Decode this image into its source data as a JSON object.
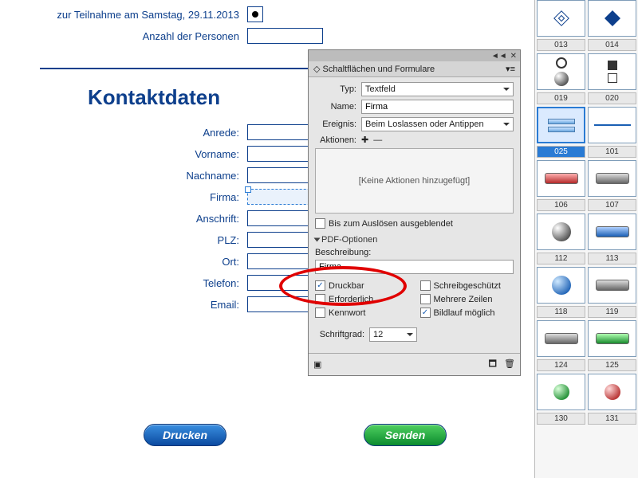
{
  "form": {
    "participation_label": "zur Teilnahme am Samstag, 29.11.2013",
    "persons_label": "Anzahl der Personen",
    "section_title": "Kontaktdaten",
    "fields": {
      "anrede": "Anrede:",
      "vorname": "Vorname:",
      "nachname": "Nachname:",
      "firma": "Firma:",
      "anschrift": "Anschrift:",
      "plz": "PLZ:",
      "ort": "Ort:",
      "telefon": "Telefon:",
      "email": "Email:"
    },
    "buttons": {
      "print": "Drucken",
      "send": "Senden"
    }
  },
  "panel": {
    "tab_title": "Schaltflächen und Formulare",
    "typ_label": "Typ:",
    "typ_value": "Textfeld",
    "name_label": "Name:",
    "name_value": "Firma",
    "ereignis_label": "Ereignis:",
    "ereignis_value": "Beim Loslassen oder Antippen",
    "aktionen_label": "Aktionen:",
    "no_actions": "[Keine Aktionen hinzugefügt]",
    "hide_until_trigger": "Bis zum Auslösen ausgeblendet",
    "pdf_options": "PDF-Optionen",
    "beschreibung_label": "Beschreibung:",
    "beschreibung_value": "Firma",
    "cb_druckbar": "Druckbar",
    "cb_schreibgeschuetzt": "Schreibgeschützt",
    "cb_erforderlich": "Erforderlich",
    "cb_mehrere_zeilen": "Mehrere Zeilen",
    "cb_kennwort": "Kennwort",
    "cb_bildlauf": "Bildlauf möglich",
    "schriftgrad_label": "Schriftgrad:",
    "schriftgrad_value": "12",
    "checks": {
      "druckbar": true,
      "schreibgeschuetzt": false,
      "erforderlich": false,
      "mehrere_zeilen": false,
      "kennwort": false,
      "bildlauf": true,
      "hide_until": false
    }
  },
  "library": {
    "labels": [
      "013",
      "014",
      "019",
      "020",
      "025",
      "101",
      "106",
      "107",
      "112",
      "113",
      "118",
      "119",
      "124",
      "125",
      "130",
      "131"
    ]
  }
}
